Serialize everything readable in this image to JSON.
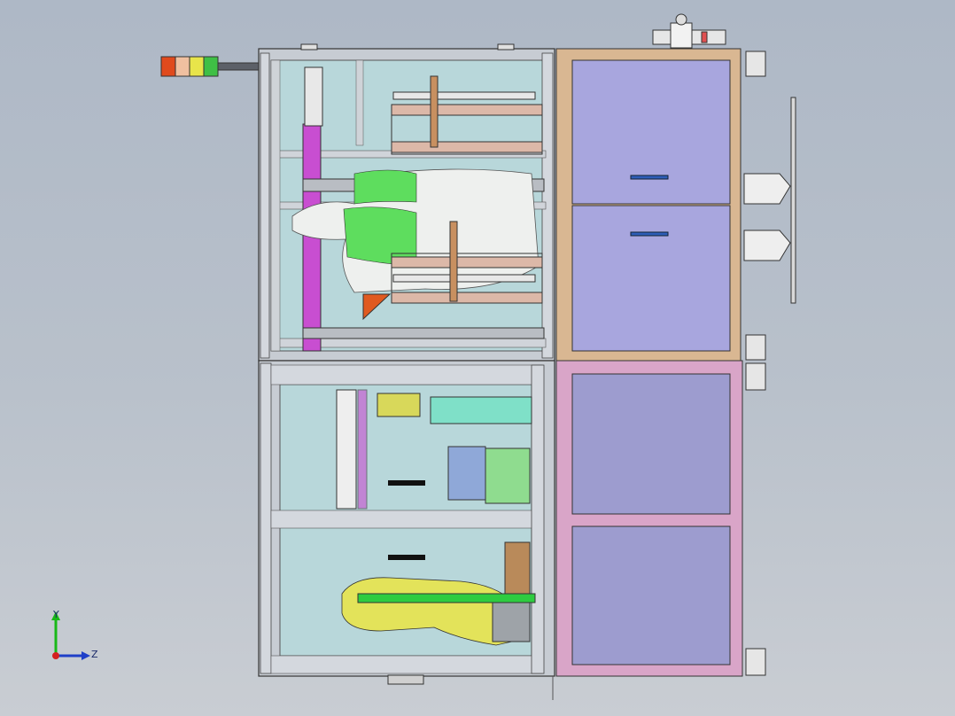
{
  "axes": {
    "y_label": "Y",
    "z_label": "Z"
  },
  "colors": {
    "background_top": "#aeb8c6",
    "frame": "#c7ccd3",
    "cabinet_blue": "#a8a6de",
    "cabinet_lower": "#9d9ccf",
    "cabinet_trim_tan": "#d9b792",
    "cabinet_trim_pink": "#d9a5c8",
    "purple_bar": "#c84ed1",
    "green_part": "#5edd5e",
    "yellow_robot": "#e3e35a",
    "glass": "#9dc7c9",
    "light_red": "#e04a1d",
    "light_orange": "#e9a02a",
    "light_yellow": "#e8e44a",
    "light_green": "#3fbf45"
  },
  "status_light": {
    "segments": [
      "red",
      "orange",
      "yellow",
      "green"
    ]
  }
}
